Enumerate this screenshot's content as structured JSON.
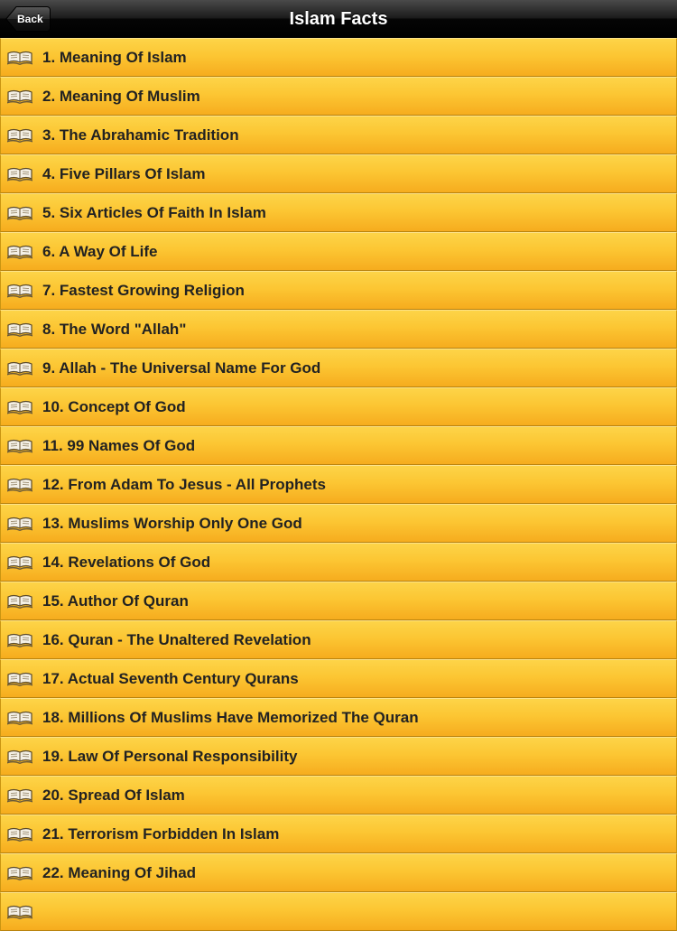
{
  "navbar": {
    "title": "Islam Facts",
    "back_label": "Back"
  },
  "list": {
    "row_icon": "open-book-icon",
    "items": [
      {
        "label": "1. Meaning Of Islam"
      },
      {
        "label": "2. Meaning Of Muslim"
      },
      {
        "label": "3. The Abrahamic Tradition"
      },
      {
        "label": "4. Five Pillars Of Islam"
      },
      {
        "label": "5. Six Articles Of Faith In Islam"
      },
      {
        "label": "6. A Way Of Life"
      },
      {
        "label": "7. Fastest Growing Religion"
      },
      {
        "label": "8. The Word \"Allah\""
      },
      {
        "label": "9. Allah - The Universal Name For God"
      },
      {
        "label": "10. Concept Of God"
      },
      {
        "label": "11. 99 Names Of God"
      },
      {
        "label": "12. From Adam To Jesus - All Prophets"
      },
      {
        "label": "13. Muslims Worship Only One God"
      },
      {
        "label": "14. Revelations Of God"
      },
      {
        "label": "15. Author Of Quran"
      },
      {
        "label": "16. Quran - The Unaltered Revelation"
      },
      {
        "label": "17. Actual Seventh Century Qurans"
      },
      {
        "label": "18. Millions Of Muslims Have Memorized The Quran"
      },
      {
        "label": "19. Law Of Personal Responsibility"
      },
      {
        "label": "20. Spread Of Islam"
      },
      {
        "label": "21. Terrorism Forbidden In Islam"
      },
      {
        "label": "22. Meaning Of Jihad"
      },
      {
        "label": ""
      }
    ]
  },
  "colors": {
    "navbar": "#000000",
    "row_top": "#fdd448",
    "row_bottom": "#f6ac1e",
    "row_text": "#222222"
  }
}
